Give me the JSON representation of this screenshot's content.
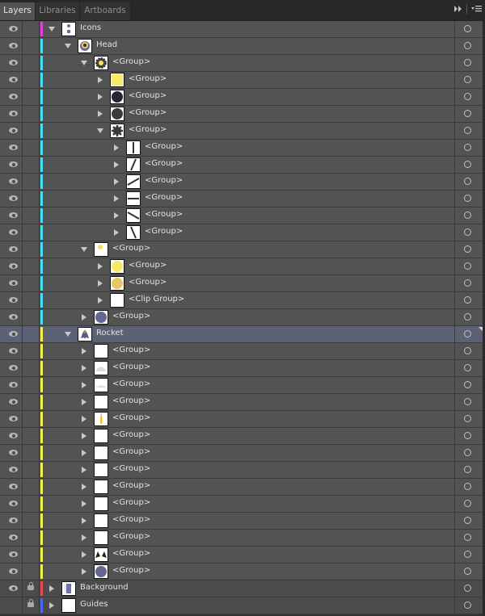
{
  "tabs": [
    {
      "label": "Layers",
      "active": true
    },
    {
      "label": "Libraries",
      "active": false
    },
    {
      "label": "Artboards",
      "active": false
    }
  ],
  "toolbar": {
    "collapse_icon": "double-chevron-right-icon",
    "menu_icon": "panel-menu-icon"
  },
  "colors": {
    "magenta": "#e040e0",
    "cyan": "#3fe0f0",
    "yellow": "#f5f04a",
    "red": "#e8484c",
    "blue": "#4a6ae8",
    "selected_row": "#5b6273"
  },
  "rows": [
    {
      "label": "Icons",
      "depth": 0,
      "expanded": true,
      "visible": true,
      "locked": false,
      "color": "#e040e0",
      "thumb": "icons",
      "kind": "layer"
    },
    {
      "label": "Head",
      "depth": 1,
      "expanded": true,
      "visible": true,
      "locked": false,
      "color": "#3fe0f0",
      "thumb": "head",
      "kind": "layer"
    },
    {
      "label": "<Group>",
      "depth": 2,
      "expanded": true,
      "visible": true,
      "locked": false,
      "color": "#3fe0f0",
      "thumb": "sun-gear"
    },
    {
      "label": "<Group>",
      "depth": 3,
      "expanded": false,
      "visible": true,
      "locked": false,
      "color": "#3fe0f0",
      "thumb": "yellow-square"
    },
    {
      "label": "<Group>",
      "depth": 3,
      "expanded": false,
      "visible": true,
      "locked": false,
      "color": "#3fe0f0",
      "thumb": "dark-purple-circle"
    },
    {
      "label": "<Group>",
      "depth": 3,
      "expanded": false,
      "visible": true,
      "locked": false,
      "color": "#3fe0f0",
      "thumb": "dark-gray-circle"
    },
    {
      "label": "<Group>",
      "depth": 3,
      "expanded": true,
      "visible": true,
      "locked": false,
      "color": "#3fe0f0",
      "thumb": "gear"
    },
    {
      "label": "<Group>",
      "depth": 4,
      "expanded": false,
      "visible": true,
      "locked": false,
      "color": "#3fe0f0",
      "thumb": "line-vertical"
    },
    {
      "label": "<Group>",
      "depth": 4,
      "expanded": false,
      "visible": true,
      "locked": false,
      "color": "#3fe0f0",
      "thumb": "line-steep"
    },
    {
      "label": "<Group>",
      "depth": 4,
      "expanded": false,
      "visible": true,
      "locked": false,
      "color": "#3fe0f0",
      "thumb": "line-shallow"
    },
    {
      "label": "<Group>",
      "depth": 4,
      "expanded": false,
      "visible": true,
      "locked": false,
      "color": "#3fe0f0",
      "thumb": "line-horizontal"
    },
    {
      "label": "<Group>",
      "depth": 4,
      "expanded": false,
      "visible": true,
      "locked": false,
      "color": "#3fe0f0",
      "thumb": "line-down-shallow"
    },
    {
      "label": "<Group>",
      "depth": 4,
      "expanded": false,
      "visible": true,
      "locked": false,
      "color": "#3fe0f0",
      "thumb": "line-down-steep"
    },
    {
      "label": "<Group>",
      "depth": 2,
      "expanded": true,
      "visible": true,
      "locked": false,
      "color": "#3fe0f0",
      "thumb": "small-yellow-dot"
    },
    {
      "label": "<Group>",
      "depth": 3,
      "expanded": false,
      "visible": true,
      "locked": false,
      "color": "#3fe0f0",
      "thumb": "yellow-circle"
    },
    {
      "label": "<Group>",
      "depth": 3,
      "expanded": false,
      "visible": true,
      "locked": false,
      "color": "#3fe0f0",
      "thumb": "gold-circle"
    },
    {
      "label": "<Clip Group>",
      "depth": 3,
      "expanded": false,
      "visible": true,
      "locked": false,
      "color": "#3fe0f0",
      "thumb": "blank"
    },
    {
      "label": "<Group>",
      "depth": 2,
      "expanded": false,
      "visible": true,
      "locked": false,
      "color": "#3fe0f0",
      "thumb": "slate-circle"
    },
    {
      "label": "Rocket",
      "depth": 1,
      "expanded": true,
      "visible": true,
      "locked": false,
      "color": "#f5f04a",
      "thumb": "rocket",
      "kind": "layer",
      "selected": true
    },
    {
      "label": "<Group>",
      "depth": 2,
      "expanded": false,
      "visible": true,
      "locked": false,
      "color": "#f5f04a",
      "thumb": "blank"
    },
    {
      "label": "<Group>",
      "depth": 2,
      "expanded": false,
      "visible": true,
      "locked": false,
      "color": "#f5f04a",
      "thumb": "cloud-dome"
    },
    {
      "label": "<Group>",
      "depth": 2,
      "expanded": false,
      "visible": true,
      "locked": false,
      "color": "#f5f04a",
      "thumb": "cloud-low"
    },
    {
      "label": "<Group>",
      "depth": 2,
      "expanded": false,
      "visible": true,
      "locked": false,
      "color": "#f5f04a",
      "thumb": "blank"
    },
    {
      "label": "<Group>",
      "depth": 2,
      "expanded": false,
      "visible": true,
      "locked": false,
      "color": "#f5f04a",
      "thumb": "flame"
    },
    {
      "label": "<Group>",
      "depth": 2,
      "expanded": false,
      "visible": true,
      "locked": false,
      "color": "#f5f04a",
      "thumb": "blank"
    },
    {
      "label": "<Group>",
      "depth": 2,
      "expanded": false,
      "visible": true,
      "locked": false,
      "color": "#f5f04a",
      "thumb": "blank"
    },
    {
      "label": "<Group>",
      "depth": 2,
      "expanded": false,
      "visible": true,
      "locked": false,
      "color": "#f5f04a",
      "thumb": "blank"
    },
    {
      "label": "<Group>",
      "depth": 2,
      "expanded": false,
      "visible": true,
      "locked": false,
      "color": "#f5f04a",
      "thumb": "blank"
    },
    {
      "label": "<Group>",
      "depth": 2,
      "expanded": false,
      "visible": true,
      "locked": false,
      "color": "#f5f04a",
      "thumb": "blank"
    },
    {
      "label": "<Group>",
      "depth": 2,
      "expanded": false,
      "visible": true,
      "locked": false,
      "color": "#f5f04a",
      "thumb": "blank"
    },
    {
      "label": "<Group>",
      "depth": 2,
      "expanded": false,
      "visible": true,
      "locked": false,
      "color": "#f5f04a",
      "thumb": "blank"
    },
    {
      "label": "<Group>",
      "depth": 2,
      "expanded": false,
      "visible": true,
      "locked": false,
      "color": "#f5f04a",
      "thumb": "fins"
    },
    {
      "label": "<Group>",
      "depth": 2,
      "expanded": false,
      "visible": true,
      "locked": false,
      "color": "#f5f04a",
      "thumb": "slate-circle"
    },
    {
      "label": "Background",
      "depth": 0,
      "expanded": false,
      "visible": true,
      "locked": true,
      "color": "#e8484c",
      "thumb": "background",
      "kind": "layer"
    },
    {
      "label": "Guides",
      "depth": 0,
      "expanded": false,
      "visible": false,
      "locked": true,
      "color": "#4a6ae8",
      "thumb": "blank",
      "kind": "layer"
    }
  ]
}
